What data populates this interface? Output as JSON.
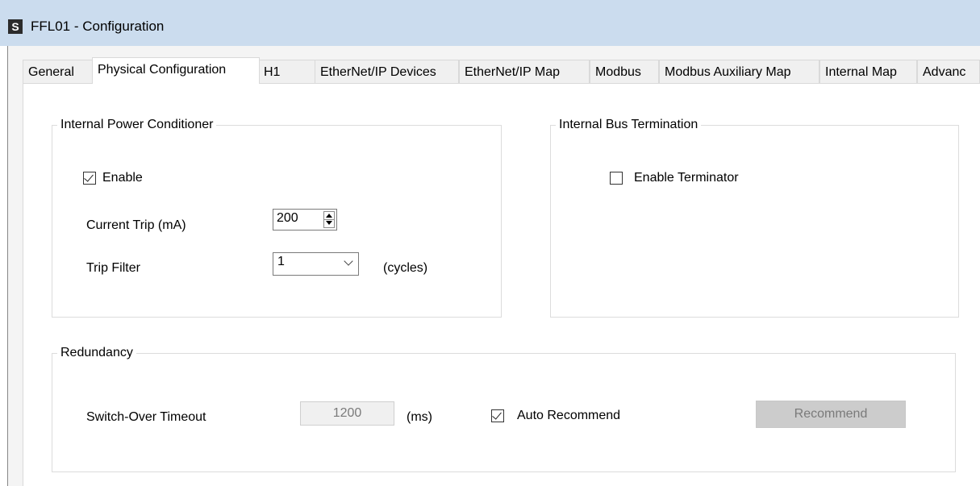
{
  "window": {
    "icon_glyph": "S",
    "title": "FFL01 - Configuration"
  },
  "tabs": [
    {
      "label": "General",
      "active": false
    },
    {
      "label": "Physical Configuration",
      "active": true
    },
    {
      "label": "H1",
      "active": false
    },
    {
      "label": "EtherNet/IP Devices",
      "active": false
    },
    {
      "label": "EtherNet/IP Map",
      "active": false
    },
    {
      "label": "Modbus",
      "active": false
    },
    {
      "label": "Modbus Auxiliary Map",
      "active": false
    },
    {
      "label": "Internal Map",
      "active": false
    },
    {
      "label": "Advanc",
      "active": false
    }
  ],
  "power_conditioner": {
    "title": "Internal Power Conditioner",
    "enable_label": "Enable",
    "enable_checked": true,
    "current_trip_label": "Current Trip (mA)",
    "current_trip_value": "200",
    "trip_filter_label": "Trip Filter",
    "trip_filter_value": "1",
    "trip_filter_unit": "(cycles)"
  },
  "bus_termination": {
    "title": "Internal Bus Termination",
    "enable_terminator_label": "Enable Terminator",
    "enable_terminator_checked": false
  },
  "redundancy": {
    "title": "Redundancy",
    "switchover_label": "Switch-Over Timeout",
    "switchover_value": "1200",
    "switchover_unit": "(ms)",
    "auto_recommend_label": "Auto Recommend",
    "auto_recommend_checked": true,
    "recommend_button": "Recommend"
  }
}
